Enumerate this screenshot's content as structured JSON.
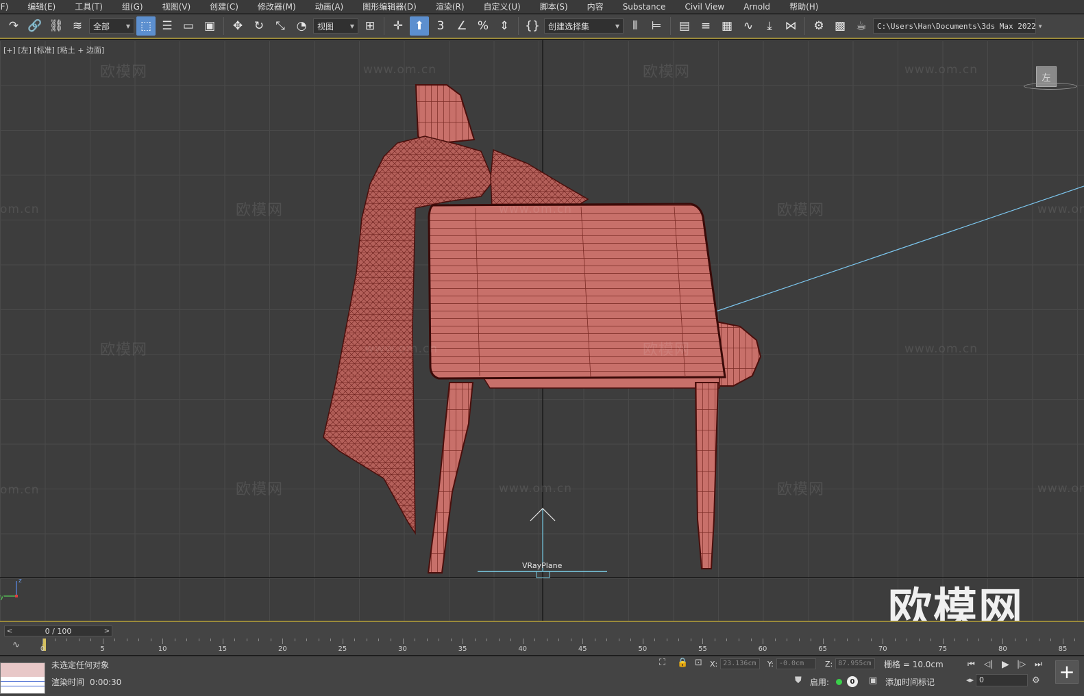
{
  "menu": [
    "(F)",
    "编辑(E)",
    "工具(T)",
    "组(G)",
    "视图(V)",
    "创建(C)",
    "修改器(M)",
    "动画(A)",
    "图形编辑器(D)",
    "渲染(R)",
    "自定义(U)",
    "脚本(S)",
    "内容",
    "Substance",
    "Civil View",
    "Arnold",
    "帮助(H)"
  ],
  "toolbar": {
    "selection_filter": "全部",
    "ref_coord": "视图",
    "named_selection": "创建选择集",
    "path": "C:\\Users\\Han\\Documents\\3ds Max 2022"
  },
  "viewport": {
    "label": "[+] [左] [标准] [粘土 + 边面]",
    "viewcube_face": "左",
    "object_label": "VRayPlane",
    "watermark_cn": "欧模网",
    "watermark_url": "www.om.cn",
    "watermark_partial": "om.cn",
    "brand": "欧模网",
    "axis_z": "z",
    "axis_y": "y"
  },
  "timeline": {
    "slider": "0 / 100",
    "ticks": [
      "0",
      "5",
      "10",
      "15",
      "20",
      "25",
      "30",
      "35",
      "40",
      "45",
      "50",
      "55",
      "60",
      "65",
      "70",
      "75",
      "80",
      "85"
    ]
  },
  "status": {
    "selection": "未选定任何对象",
    "render_time_label": "渲染时间",
    "render_time_value": "0:00:30",
    "x_label": "X:",
    "x_value": "23.136cm",
    "y_label": "Y:",
    "y_value": "-0.0cm",
    "z_label": "Z:",
    "z_value": "87.955cm",
    "grid": "栅格 = 10.0cm",
    "enable": "启用:",
    "enable_count": "0",
    "add_time_tag": "添加时间标记",
    "frame": "0"
  },
  "colors": {
    "accent": "#5c8fcf",
    "model": "#c8706a",
    "wire": "#6a1e1a",
    "gizmo": "#7cd0e8",
    "timeline_border": "#9a8a3a"
  }
}
